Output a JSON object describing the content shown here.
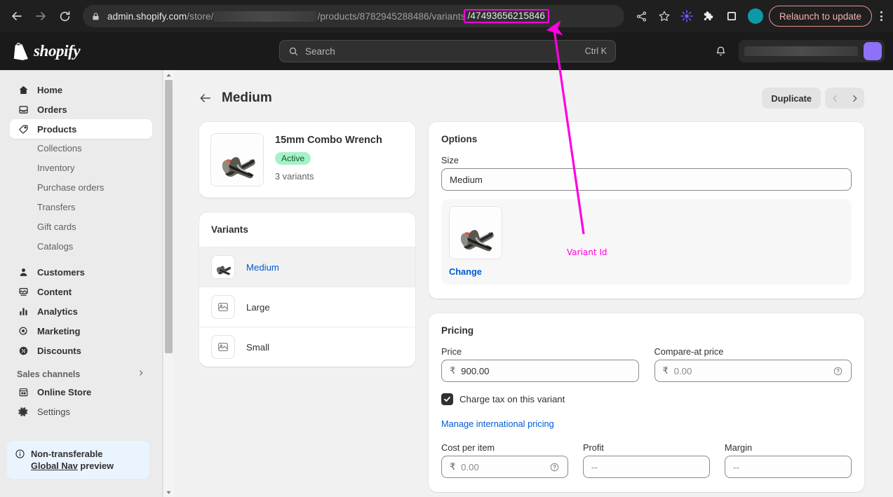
{
  "browser": {
    "back_icon": "back-arrow-icon",
    "forward_icon": "forward-arrow-icon",
    "reload_icon": "reload-icon",
    "lock_icon": "lock-icon",
    "url": {
      "prefix": "admin.shopify.com",
      "store_path": "/store/",
      "redacted": "",
      "product_path": "/products/8782945288486/variants",
      "variant_id": "/47493656215846",
      "highlight_color": "#ff00e0"
    },
    "icons": {
      "share": "share-icon",
      "bookmark": "star-icon",
      "extension_starburst": "starburst-extension-icon",
      "extensions": "puzzle-piece-icon",
      "side_panel": "side-panel-icon",
      "profile": "profile-avatar-icon"
    },
    "relaunch_label": "Relaunch to update",
    "menu_icon": "kebab-menu-icon"
  },
  "topbar": {
    "brand": "shopify",
    "logo_icon": "shopify-bag-icon",
    "search_icon": "search-icon",
    "search_placeholder": "Search",
    "search_shortcut": "Ctrl K",
    "bell_icon": "notification-bell-icon",
    "store_name": "",
    "avatar": "user-avatar"
  },
  "sidebar": {
    "items": [
      {
        "label": "Home",
        "icon": "home-icon",
        "selected": false
      },
      {
        "label": "Orders",
        "icon": "orders-inbox-icon",
        "selected": false
      },
      {
        "label": "Products",
        "icon": "products-tag-icon",
        "selected": true
      }
    ],
    "sub_items": [
      "Collections",
      "Inventory",
      "Purchase orders",
      "Transfers",
      "Gift cards",
      "Catalogs"
    ],
    "items2": [
      {
        "label": "Customers",
        "icon": "customers-person-icon"
      },
      {
        "label": "Content",
        "icon": "content-image-icon"
      },
      {
        "label": "Analytics",
        "icon": "analytics-bars-icon"
      },
      {
        "label": "Marketing",
        "icon": "marketing-target-icon"
      },
      {
        "label": "Discounts",
        "icon": "discounts-badge-icon"
      }
    ],
    "sales_channels_label": "Sales channels",
    "sales_channels_chevron": "chevron-right-icon",
    "items3": [
      {
        "label": "Online Store",
        "icon": "online-store-icon"
      },
      {
        "label": "Settings",
        "icon": "gear-icon"
      }
    ],
    "banner": {
      "icon": "info-circle-icon",
      "line1": "Non-transferable",
      "link": "Global Nav",
      "line2_suffix": " preview"
    },
    "scrollbar": {
      "up_icon": "scroll-up-arrow",
      "down_icon": "scroll-down-arrow"
    }
  },
  "page": {
    "back_icon": "back-arrow-icon",
    "title": "Medium",
    "duplicate_label": "Duplicate",
    "prev_icon": "chevron-left-icon",
    "next_icon": "chevron-right-icon"
  },
  "product": {
    "thumbnail": "sneakers-product-image",
    "name": "15mm Combo Wrench",
    "status": "Active",
    "status_color": "#a6f2c8",
    "variant_count": "3 variants"
  },
  "variants": {
    "title": "Variants",
    "rows": [
      {
        "name": "Medium",
        "selected": true,
        "thumb": "sneakers-product-image"
      },
      {
        "name": "Large",
        "selected": false,
        "thumb": "image-placeholder-icon"
      },
      {
        "name": "Small",
        "selected": false,
        "thumb": "image-placeholder-icon"
      }
    ]
  },
  "options": {
    "title": "Options",
    "size_label": "Size",
    "size_value": "Medium",
    "variant_image": "sneakers-product-image",
    "change_label": "Change"
  },
  "pricing": {
    "title": "Pricing",
    "price_label": "Price",
    "price_currency": "₹",
    "price_value": "900.00",
    "compare_label": "Compare-at price",
    "compare_currency": "₹",
    "compare_value": "0.00",
    "compare_help_icon": "help-circle-icon",
    "tax_label": "Charge tax on this variant",
    "tax_checked": true,
    "international_link": "Manage international pricing",
    "cost_label": "Cost per item",
    "cost_currency": "₹",
    "cost_value": "0.00",
    "cost_help_icon": "help-circle-icon",
    "profit_label": "Profit",
    "profit_value": "--",
    "margin_label": "Margin",
    "margin_value": "--"
  },
  "annotation": {
    "label": "Variant Id",
    "color": "#ff00e0"
  }
}
